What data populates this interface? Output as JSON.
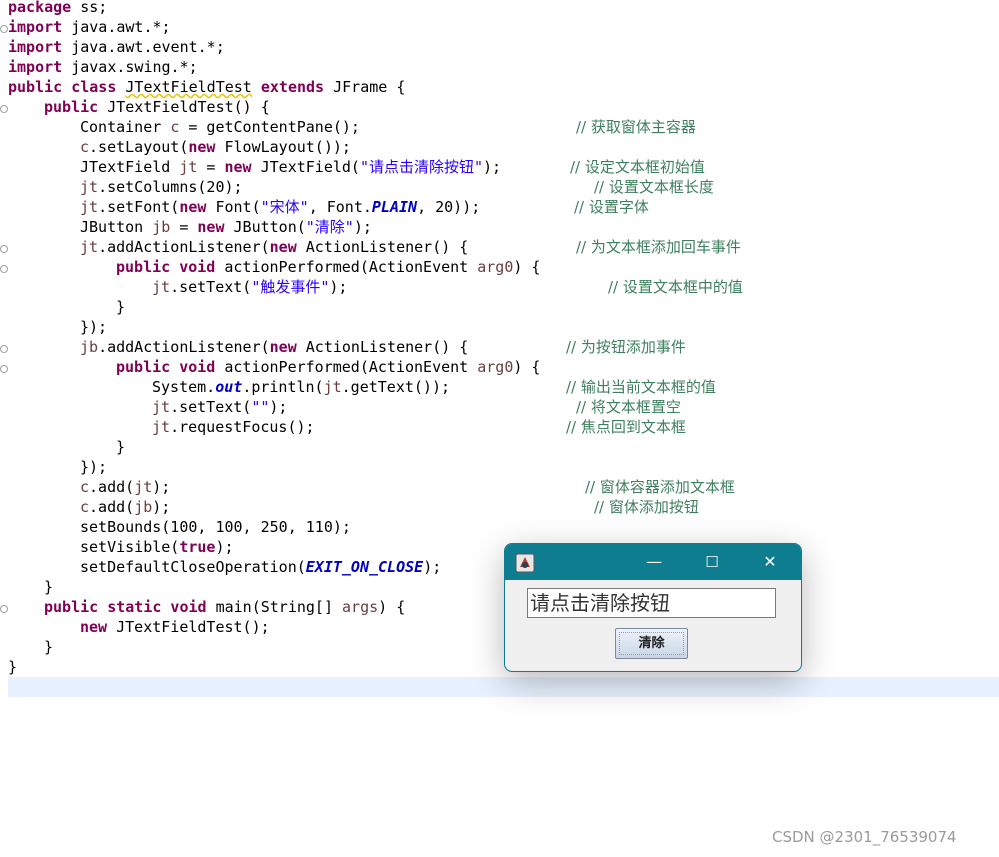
{
  "editor": {
    "lines": [
      {
        "kw": "package",
        "rest": " ss;"
      },
      {
        "kw": "import",
        "rest": " java.awt.*;"
      },
      {
        "kw": "import",
        "rest": " java.awt.event.*;"
      },
      {
        "kw": "import",
        "rest": " javax.swing.*;"
      },
      {
        "kw": "public class",
        "cls": "JTextFieldTest",
        "kw2": "extends",
        "rest": " JFrame {"
      },
      {
        "kw": "public",
        "rest": " JTextFieldTest() {"
      },
      {
        "a": "Container ",
        "v": "c",
        "b": " = getContentPane();"
      },
      {
        "v": "c",
        "a": ".setLayout(",
        "kw": "new",
        "b": " FlowLayout());"
      },
      {
        "a": "JTextField ",
        "v": "jt",
        "b": " = ",
        "kw": "new",
        "c": " JTextField(",
        "s": "\"请点击清除按钮\"",
        "d": ");"
      },
      {
        "v": "jt",
        "a": ".setColumns(20);"
      },
      {
        "v": "jt",
        "a": ".setFont(",
        "kw": "new",
        "b": " Font(",
        "s": "\"宋体\"",
        "c": ", Font.",
        "f": "PLAIN",
        "d": ", 20));"
      },
      {
        "a": "JButton ",
        "v": "jb",
        "b": " = ",
        "kw": "new",
        "c": " JButton(",
        "s": "\"清除\"",
        "d": ");"
      },
      {
        "v": "jt",
        "a": ".addActionListener(",
        "kw": "new",
        "b": " ActionListener() {"
      },
      {
        "kw": "public void",
        "a": " actionPerformed(ActionEvent ",
        "v": "arg0",
        "b": ") {"
      },
      {
        "v": "jt",
        "a": ".setText(",
        "s": "\"触发事件\"",
        "b": ");"
      },
      {
        "a": "}"
      },
      {
        "a": "});"
      },
      {
        "v": "jb",
        "a": ".addActionListener(",
        "kw": "new",
        "b": " ActionListener() {"
      },
      {
        "kw": "public void",
        "a": " actionPerformed(ActionEvent ",
        "v": "arg0",
        "b": ") {"
      },
      {
        "a": "System.",
        "f": "out",
        "b": ".println(",
        "v": "jt",
        "c": ".getText());"
      },
      {
        "v": "jt",
        "a": ".setText(",
        "s": "\"\"",
        "b": ");"
      },
      {
        "v": "jt",
        "a": ".requestFocus();"
      },
      {
        "a": "}"
      },
      {
        "a": "});"
      },
      {
        "v": "c",
        "a": ".add(",
        "v2": "jt",
        "b": ");"
      },
      {
        "v": "c",
        "a": ".add(",
        "v2": "jb",
        "b": ");"
      },
      {
        "a": "setBounds(100, 100, 250, 110);"
      },
      {
        "a": "setVisible(",
        "kw": "true",
        "b": ");"
      },
      {
        "a": "setDefaultCloseOperation(",
        "f": "EXIT_ON_CLOSE",
        "b": ");"
      },
      {
        "a": "}"
      },
      {
        "kw": "public static void",
        "a": " main(String[] ",
        "v": "args",
        "b": ") {"
      },
      {
        "kw": "new",
        "a": " JTextFieldTest();"
      },
      {
        "a": "}"
      },
      {
        "a": "}"
      }
    ],
    "comments": {
      "c6": "// 获取窗体主容器",
      "c8": "// 设定文本框初始值",
      "c9": "// 设置文本框长度",
      "c10": "// 设置字体",
      "c12": "// 为文本框添加回车事件",
      "c14": "// 设置文本框中的值",
      "c17": "// 为按钮添加事件",
      "c19": "// 输出当前文本框的值",
      "c20": "// 将文本框置空",
      "c21": "// 焦点回到文本框",
      "c24": "// 窗体容器添加文本框",
      "c25": "// 窗体添加按钮"
    }
  },
  "app_window": {
    "minimize_glyph": "—",
    "maximize_glyph": "☐",
    "close_glyph": "✕",
    "text_field_value": "请点击清除按钮",
    "button_label": "清除",
    "title_bar_color": "#0e7d8f"
  },
  "watermark": "CSDN @2301_76539074"
}
